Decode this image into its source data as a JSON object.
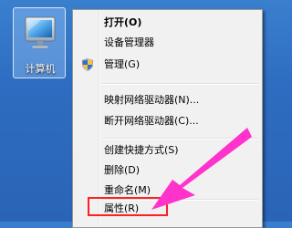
{
  "desktop": {
    "icon": {
      "label": "计算机",
      "icon_name": "computer-icon"
    }
  },
  "context_menu": {
    "items": [
      {
        "label": "打开(O)",
        "bold": true
      },
      {
        "label": "设备管理器"
      },
      {
        "label": "管理(G)",
        "icon": "uac-shield-icon"
      },
      {
        "label": "映射网络驱动器(N)..."
      },
      {
        "label": "断开网络驱动器(C)..."
      },
      {
        "label": "创建快捷方式(S)"
      },
      {
        "label": "删除(D)"
      },
      {
        "label": "重命名(M)"
      },
      {
        "label": "属性(R)",
        "highlighted": true
      }
    ]
  },
  "annotation": {
    "highlight_color": "#ff2020",
    "arrow_color": "#ff33cc",
    "arrow_target": "属性(R)"
  },
  "colors": {
    "desktop_blue": "#2d6cc0",
    "menu_background": "#f1f1f1"
  }
}
